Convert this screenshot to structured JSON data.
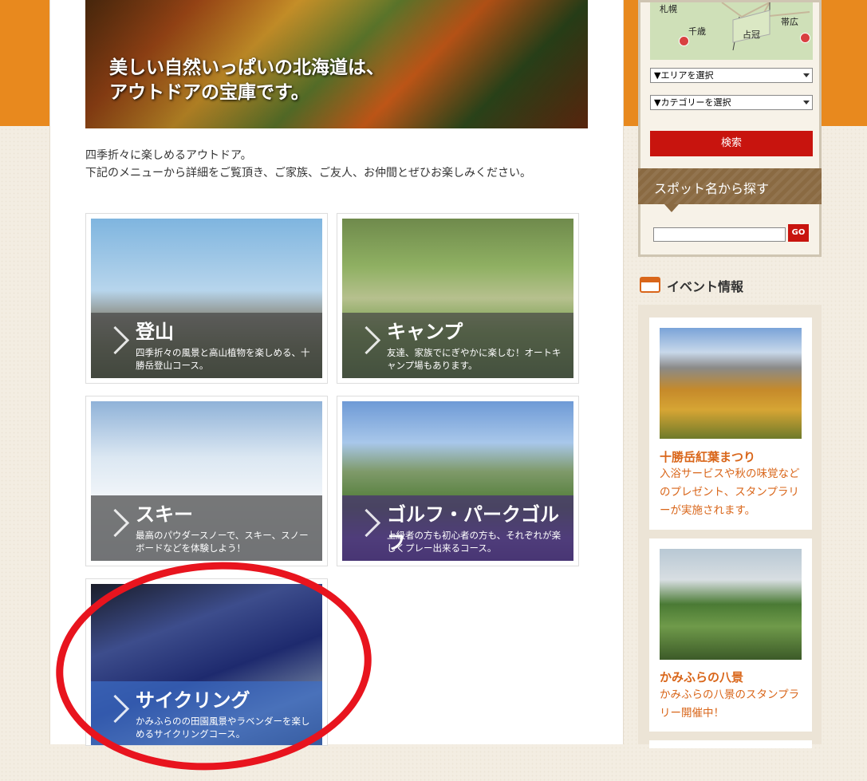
{
  "hero": {
    "line1": "美しい自然いっぱいの北海道は、",
    "line2": "アウトドアの宝庫です。"
  },
  "intro": {
    "line1": "四季折々に楽しめるアウトドア。",
    "line2": "下記のメニューから詳細をご覧頂き、ご家族、ご友人、お仲間とぜひお楽しみください。"
  },
  "activities": [
    {
      "title": "登山",
      "desc": "四季折々の風景と高山植物を楽しめる、十勝岳登山コース。"
    },
    {
      "title": "キャンプ",
      "desc": "友達、家族でにぎやかに楽しむ！オートキャンプ場もあります。"
    },
    {
      "title": "スキー",
      "desc": "最高のパウダースノーで、スキー、スノーボードなどを体験しよう！"
    },
    {
      "title": "ゴルフ・パークゴルフ",
      "desc": "上級者の方も初心者の方も、それぞれが楽しくプレー出来るコース。"
    },
    {
      "title": "サイクリング",
      "desc": "かみふらのの田園風景やラベンダーを楽しめるサイクリングコース。"
    }
  ],
  "map": {
    "labels": [
      "札幌",
      "千歳",
      "占冠",
      "帯広"
    ]
  },
  "search": {
    "area_select": "▼エリアを選択",
    "category_select": "▼カテゴリーを選択",
    "search_button": "検索",
    "spot_heading": "スポット名から探す",
    "go_button": "GO"
  },
  "events": {
    "heading": "イベント情報",
    "items": [
      {
        "name": "十勝岳紅葉まつり",
        "desc": "入浴サービスや秋の味覚などのプレゼント、スタンプラリーが実施されます。"
      },
      {
        "name": "かみふらの八景",
        "desc": "かみふらの八景のスタンプラリー開催中！"
      }
    ]
  },
  "colors": {
    "orange": "#e8891e",
    "red": "#c8140e",
    "event_text": "#d9661a",
    "highlight": "#e8141e"
  }
}
